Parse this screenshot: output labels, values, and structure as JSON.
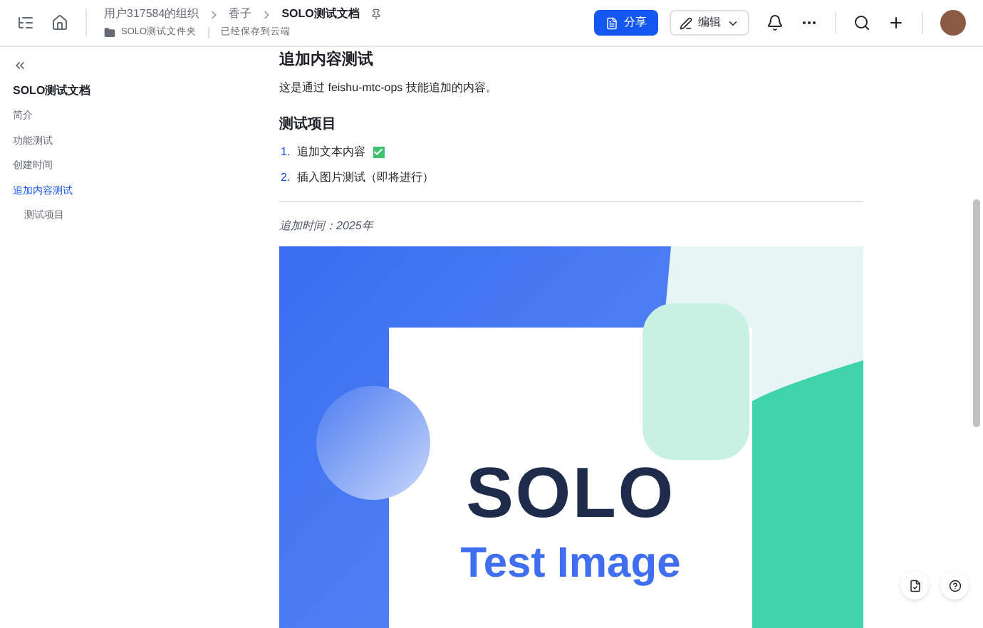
{
  "header": {
    "breadcrumbs": [
      "用户317584的组织",
      "香子",
      "SOLO测试文档"
    ],
    "folder": "SOLO测试文件夹",
    "save_status": "已经保存到云端",
    "share_button": "分享",
    "edit_button": "编辑"
  },
  "sidebar": {
    "title": "SOLO测试文档",
    "items": [
      {
        "label": "简介",
        "selected": false
      },
      {
        "label": "功能测试",
        "selected": false
      },
      {
        "label": "创建时间",
        "selected": false
      },
      {
        "label": "追加内容测试",
        "selected": true,
        "children": [
          {
            "label": "测试项目",
            "selected": false
          }
        ]
      }
    ]
  },
  "document": {
    "heading": "追加内容测试",
    "paragraph": "这是通过 feishu-mtc-ops 技能追加的内容。",
    "subheading": "测试项目",
    "list": [
      {
        "number": "1.",
        "text": "追加文本内容",
        "done": true
      },
      {
        "number": "2.",
        "text": "插入图片测试（即将进行）",
        "done": false
      }
    ],
    "note": "追加时间：2025年",
    "image": {
      "title": "SOLO",
      "subtitle": "Test Image"
    }
  }
}
